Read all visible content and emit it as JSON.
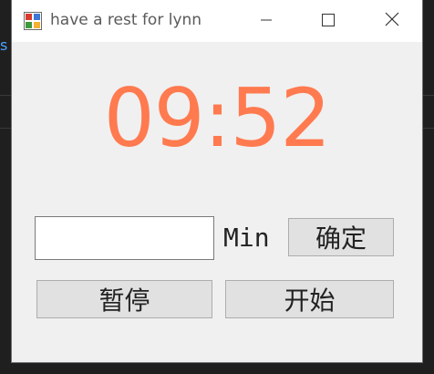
{
  "window": {
    "title": "have a rest for lynn"
  },
  "timer": {
    "display": "09:52"
  },
  "minutes_input": {
    "value": "",
    "placeholder": ""
  },
  "labels": {
    "min_unit": "Min"
  },
  "buttons": {
    "confirm_label": "确定",
    "pause_label": "暂停",
    "start_label": "开始"
  },
  "colors": {
    "timer": "#ff7a4f",
    "window_bg": "#f0f0f0",
    "button_bg": "#e1e1e1"
  },
  "icons": {
    "app": "app-window-icon",
    "minimize": "minimize-icon",
    "maximize": "maximize-icon",
    "close": "close-icon"
  },
  "background": {
    "partial_glyph": "s"
  }
}
